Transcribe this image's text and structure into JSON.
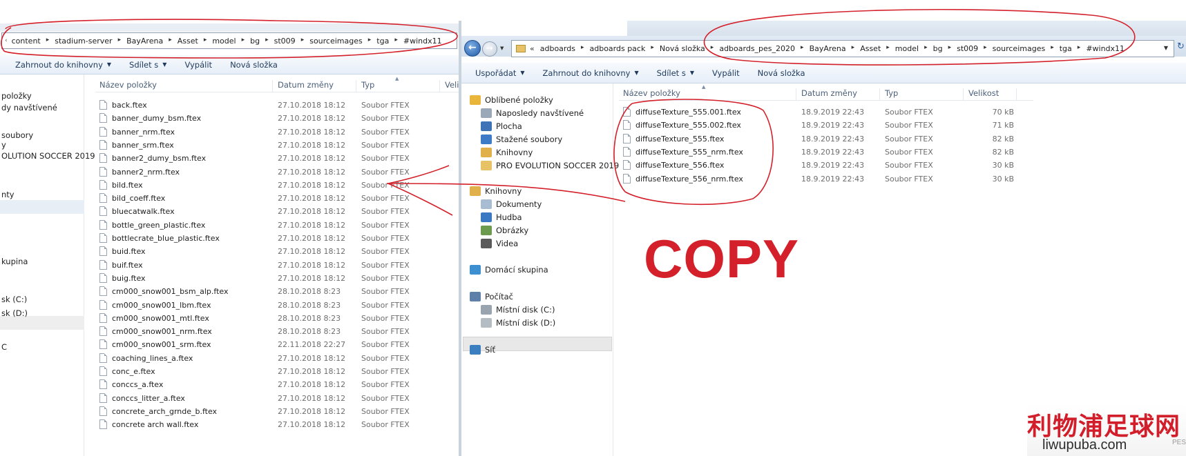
{
  "left": {
    "breadcrumb": [
      "content",
      "stadium-server",
      "BayArena",
      "Asset",
      "model",
      "bg",
      "st009",
      "sourceimages",
      "tga",
      "#windx11"
    ],
    "toolbar": {
      "include_library": "Zahrnout do knihovny",
      "share": "Sdílet s",
      "burn": "Vypálit",
      "new_folder": "Nová složka"
    },
    "columns": {
      "name": "Název položky",
      "date": "Datum změny",
      "type": "Typ",
      "size": "Veli"
    },
    "nav": [
      "položky",
      "dy navštívené",
      "soubory",
      "y",
      "OLUTION SOCCER 2019",
      "nty",
      "kupina",
      "sk (C:)",
      "sk (D:)",
      "C"
    ],
    "files": [
      {
        "name": "back.ftex",
        "date": "27.10.2018 18:12",
        "type": "Soubor FTEX"
      },
      {
        "name": "banner_dumy_bsm.ftex",
        "date": "27.10.2018 18:12",
        "type": "Soubor FTEX"
      },
      {
        "name": "banner_nrm.ftex",
        "date": "27.10.2018 18:12",
        "type": "Soubor FTEX"
      },
      {
        "name": "banner_srm.ftex",
        "date": "27.10.2018 18:12",
        "type": "Soubor FTEX"
      },
      {
        "name": "banner2_dumy_bsm.ftex",
        "date": "27.10.2018 18:12",
        "type": "Soubor FTEX"
      },
      {
        "name": "banner2_nrm.ftex",
        "date": "27.10.2018 18:12",
        "type": "Soubor FTEX"
      },
      {
        "name": "bild.ftex",
        "date": "27.10.2018 18:12",
        "type": "Soubor FTEX"
      },
      {
        "name": "bild_coeff.ftex",
        "date": "27.10.2018 18:12",
        "type": "Soubor FTEX"
      },
      {
        "name": "bluecatwalk.ftex",
        "date": "27.10.2018 18:12",
        "type": "Soubor FTEX"
      },
      {
        "name": "bottle_green_plastic.ftex",
        "date": "27.10.2018 18:12",
        "type": "Soubor FTEX"
      },
      {
        "name": "bottlecrate_blue_plastic.ftex",
        "date": "27.10.2018 18:12",
        "type": "Soubor FTEX"
      },
      {
        "name": "buid.ftex",
        "date": "27.10.2018 18:12",
        "type": "Soubor FTEX"
      },
      {
        "name": "buif.ftex",
        "date": "27.10.2018 18:12",
        "type": "Soubor FTEX"
      },
      {
        "name": "buig.ftex",
        "date": "27.10.2018 18:12",
        "type": "Soubor FTEX"
      },
      {
        "name": "cm000_snow001_bsm_alp.ftex",
        "date": "28.10.2018 8:23",
        "type": "Soubor FTEX"
      },
      {
        "name": "cm000_snow001_lbm.ftex",
        "date": "28.10.2018 8:23",
        "type": "Soubor FTEX"
      },
      {
        "name": "cm000_snow001_mtl.ftex",
        "date": "28.10.2018 8:23",
        "type": "Soubor FTEX"
      },
      {
        "name": "cm000_snow001_nrm.ftex",
        "date": "28.10.2018 8:23",
        "type": "Soubor FTEX"
      },
      {
        "name": "cm000_snow001_srm.ftex",
        "date": "22.11.2018 22:27",
        "type": "Soubor FTEX"
      },
      {
        "name": "coaching_lines_a.ftex",
        "date": "27.10.2018 18:12",
        "type": "Soubor FTEX"
      },
      {
        "name": "conc_e.ftex",
        "date": "27.10.2018 18:12",
        "type": "Soubor FTEX"
      },
      {
        "name": "conccs_a.ftex",
        "date": "27.10.2018 18:12",
        "type": "Soubor FTEX"
      },
      {
        "name": "conccs_litter_a.ftex",
        "date": "27.10.2018 18:12",
        "type": "Soubor FTEX"
      },
      {
        "name": "concrete_arch_grnde_b.ftex",
        "date": "27.10.2018 18:12",
        "type": "Soubor FTEX"
      },
      {
        "name": "concrete arch wall.ftex",
        "date": "27.10.2018 18:12",
        "type": "Soubor FTEX"
      }
    ]
  },
  "right": {
    "breadcrumb": [
      "adboards",
      "adboards pack",
      "Nová složka",
      "adboards_pes_2020",
      "BayArena",
      "Asset",
      "model",
      "bg",
      "st009",
      "sourceimages",
      "tga",
      "#windx11"
    ],
    "overflow_glyph": "«",
    "toolbar": {
      "organize": "Uspořádat",
      "include_library": "Zahrnout do knihovny",
      "share": "Sdílet s",
      "burn": "Vypálit",
      "new_folder": "Nová složka"
    },
    "columns": {
      "name": "Název položky",
      "date": "Datum změny",
      "type": "Typ",
      "size": "Velikost"
    },
    "nav": {
      "favorites": "Oblíbené položky",
      "recent": "Naposledy navštívené",
      "desktop": "Plocha",
      "downloads": "Stažené soubory",
      "libraries_fav": "Knihovny",
      "pes": "PRO EVOLUTION SOCCER 2019",
      "libraries": "Knihovny",
      "documents": "Dokumenty",
      "music": "Hudba",
      "pictures": "Obrázky",
      "videos": "Videa",
      "homegroup": "Domácí skupina",
      "computer": "Počítač",
      "disk_c": "Místní disk (C:)",
      "disk_d": "Místní disk (D:)",
      "network": "Síť"
    },
    "files": [
      {
        "name": "diffuseTexture_555.001.ftex",
        "date": "18.9.2019 22:43",
        "type": "Soubor FTEX",
        "size": "70 kB"
      },
      {
        "name": "diffuseTexture_555.002.ftex",
        "date": "18.9.2019 22:43",
        "type": "Soubor FTEX",
        "size": "71 kB"
      },
      {
        "name": "diffuseTexture_555.ftex",
        "date": "18.9.2019 22:43",
        "type": "Soubor FTEX",
        "size": "82 kB"
      },
      {
        "name": "diffuseTexture_555_nrm.ftex",
        "date": "18.9.2019 22:43",
        "type": "Soubor FTEX",
        "size": "82 kB"
      },
      {
        "name": "diffuseTexture_556.ftex",
        "date": "18.9.2019 22:43",
        "type": "Soubor FTEX",
        "size": "30 kB"
      },
      {
        "name": "diffuseTexture_556_nrm.ftex",
        "date": "18.9.2019 22:43",
        "type": "Soubor FTEX",
        "size": "30 kB"
      }
    ]
  },
  "annotation": {
    "copy": "COPY",
    "color": "#d4202a"
  },
  "watermark": {
    "chinese": "利物浦足球网",
    "url": "liwupuba.com",
    "tag": "PES"
  }
}
